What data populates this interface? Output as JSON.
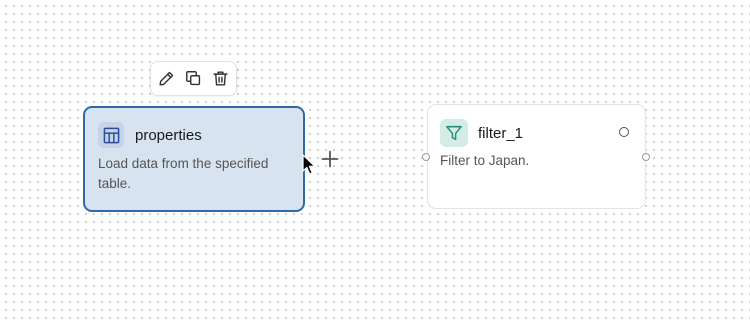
{
  "toolbar": {
    "icons": [
      "pencil-icon",
      "copy-icon",
      "trash-icon"
    ]
  },
  "nodes": [
    {
      "icon": "table-icon",
      "title": "properties",
      "description": "Load data from the specified table.",
      "selected": true
    },
    {
      "icon": "funnel-icon",
      "title": "filter_1",
      "description": "Filter to Japan.",
      "selected": false
    }
  ],
  "colors": {
    "selected_border": "#2f6aa8",
    "selected_fill": "#d8e3f0",
    "table_icon": "#2d4f99",
    "filter_icon": "#2a8f78"
  }
}
